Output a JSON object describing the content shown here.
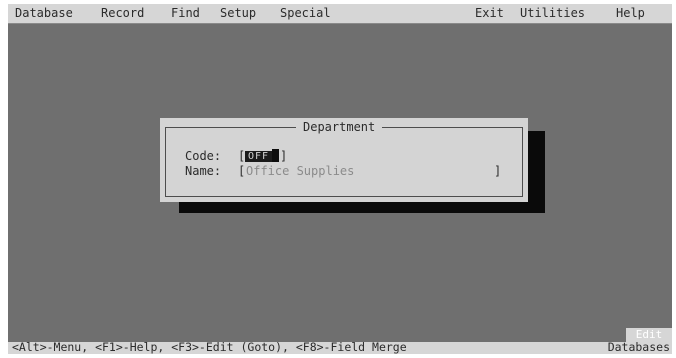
{
  "menubar": {
    "database": "Database",
    "record": "Record",
    "find": "Find",
    "setup": "Setup",
    "special": "Special",
    "exit": "Exit",
    "utilities": "Utilities",
    "help": "Help"
  },
  "dialog": {
    "title": "Department",
    "code_label": "Code:",
    "code_value": "OFF",
    "name_label": "Name:",
    "name_value": "Office Supplies"
  },
  "status": {
    "hints": "<Alt>-Menu, <F1>-Help, <F3>-Edit (Goto), <F8>-Field Merge",
    "mode": "Edit",
    "context": "Databases"
  },
  "colors": {
    "background": "#6f6f6f",
    "menubar": "#d6d6d6",
    "dialog": "#d4d4d4",
    "shadow": "#0a0a0a"
  }
}
